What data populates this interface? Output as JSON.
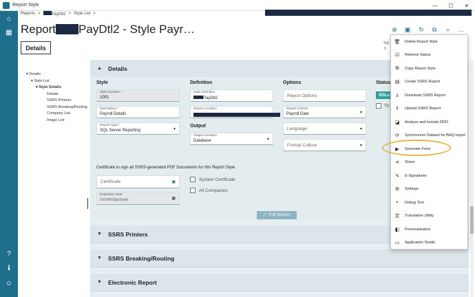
{
  "window": {
    "title": "Report Style",
    "controls": [
      "—",
      "☐",
      "✕"
    ]
  },
  "breadcrumb": {
    "items": [
      "Reports",
      "PayDtl2",
      "Style List"
    ],
    "separator": ">"
  },
  "page": {
    "title_prefix": "Report",
    "title_suffix": "PayDtl2 - Style Payr…",
    "tab_label": "Details"
  },
  "toolbar": {
    "icons": [
      "plus-circle-icon",
      "save-icon",
      "refresh-icon",
      "copy-icon",
      "search-icon",
      "more-icon"
    ],
    "glyphs": [
      "⊕",
      "▣",
      "↻",
      "⧉",
      "⌕",
      "…"
    ],
    "style_partial": "Styl",
    "number_partial": "1"
  },
  "tree": {
    "items": [
      {
        "label": "Details",
        "indent": 0,
        "expand": "▾"
      },
      {
        "label": "Style List",
        "indent": 1,
        "expand": "▾"
      },
      {
        "label": "Style Details",
        "indent": 2,
        "expand": "▾",
        "bold": true
      },
      {
        "label": "Details",
        "indent": 3,
        "expand": ""
      },
      {
        "label": "SSRS Printers",
        "indent": 3,
        "expand": ""
      },
      {
        "label": "SSRS Breaking/Routing",
        "indent": 3,
        "expand": ""
      },
      {
        "label": "Company List",
        "indent": 3,
        "expand": ""
      },
      {
        "label": "Image List",
        "indent": 3,
        "expand": ""
      }
    ]
  },
  "details": {
    "header": "Details",
    "style": {
      "title": "Style",
      "style_number_label": "Style Number *",
      "style_number_value": "1001",
      "description_label": "Description *",
      "description_value": "Payroll Details",
      "report_type_label": "Report Type *",
      "report_type_value": "SQL Server Reporting"
    },
    "definition": {
      "title": "Definition",
      "data_definition_label": "Data Definition",
      "data_definition_value": "PayDtl2",
      "report_location_label": "Report Location"
    },
    "output": {
      "title": "Output",
      "output_location_label": "Output Location",
      "output_location_value": "Database"
    },
    "options": {
      "title": "Options",
      "report_options_placeholder": "Report Options",
      "report_criteria_label": "Report Criteria",
      "report_criteria_value": "Payroll Date",
      "language_placeholder": "Language",
      "format_culture_placeholder": "Format Culture"
    },
    "status": {
      "title": "Status",
      "badge": "RDLs",
      "partial_check": "Sy"
    },
    "certificate": {
      "heading": "Certificate to sign all SSRS-generated PDF Documents for this Report Style",
      "certificate_placeholder": "Certificate",
      "expiration_label": "Expiration Date",
      "expiration_placeholder": "month/day/year",
      "system_certificate_label": "System Certificate",
      "all_companies_label": "All Companies"
    },
    "full_screen": "Full Screen"
  },
  "sections": [
    {
      "label": "SSRS Printers"
    },
    {
      "label": "SSRS Breaking/Routing"
    },
    {
      "label": "Electronic Report"
    }
  ],
  "menu": {
    "items": [
      {
        "label": "Delete Report Style",
        "icon": "trash-icon",
        "glyph": "🗑"
      },
      {
        "label": "Retrieve Status",
        "icon": "check-box-icon",
        "glyph": "☑"
      },
      {
        "label": "Copy Report Style",
        "icon": "copy-icon",
        "glyph": "⧉"
      },
      {
        "label": "Create SSRS Report",
        "icon": "file-plus-icon",
        "glyph": "▤"
      },
      {
        "label": "Download SSRS Report",
        "icon": "download-icon",
        "glyph": "⇓"
      },
      {
        "label": "Upload SSRS Report",
        "icon": "upload-icon",
        "glyph": "⇑"
      },
      {
        "label": "Analyze and Include RDD",
        "icon": "analyze-icon",
        "glyph": "◪"
      },
      {
        "label": "Synchronize Dataset for BAQ report",
        "icon": "sync-icon",
        "glyph": "⟳"
      },
      {
        "label": "Generate Form",
        "icon": "play-icon",
        "glyph": "▶"
      },
      {
        "label": "Share",
        "icon": "share-icon",
        "glyph": "⋖"
      },
      {
        "label": "E-Signatures",
        "icon": "signature-icon",
        "glyph": "✎"
      },
      {
        "label": "Settings",
        "icon": "gear-icon",
        "glyph": "⚙"
      },
      {
        "label": "Debug Tool",
        "icon": "debug-icon",
        "glyph": "▪"
      },
      {
        "label": "Translation Utility",
        "icon": "translate-icon",
        "glyph": "文"
      },
      {
        "label": "Personalization",
        "icon": "personalization-icon",
        "glyph": "◧"
      },
      {
        "label": "Application Studio",
        "icon": "monitor-icon",
        "glyph": "▭"
      }
    ]
  },
  "colors": {
    "nav": "#1f6e8c",
    "highlight": "#e3b93d",
    "badge": "#2aa198"
  }
}
